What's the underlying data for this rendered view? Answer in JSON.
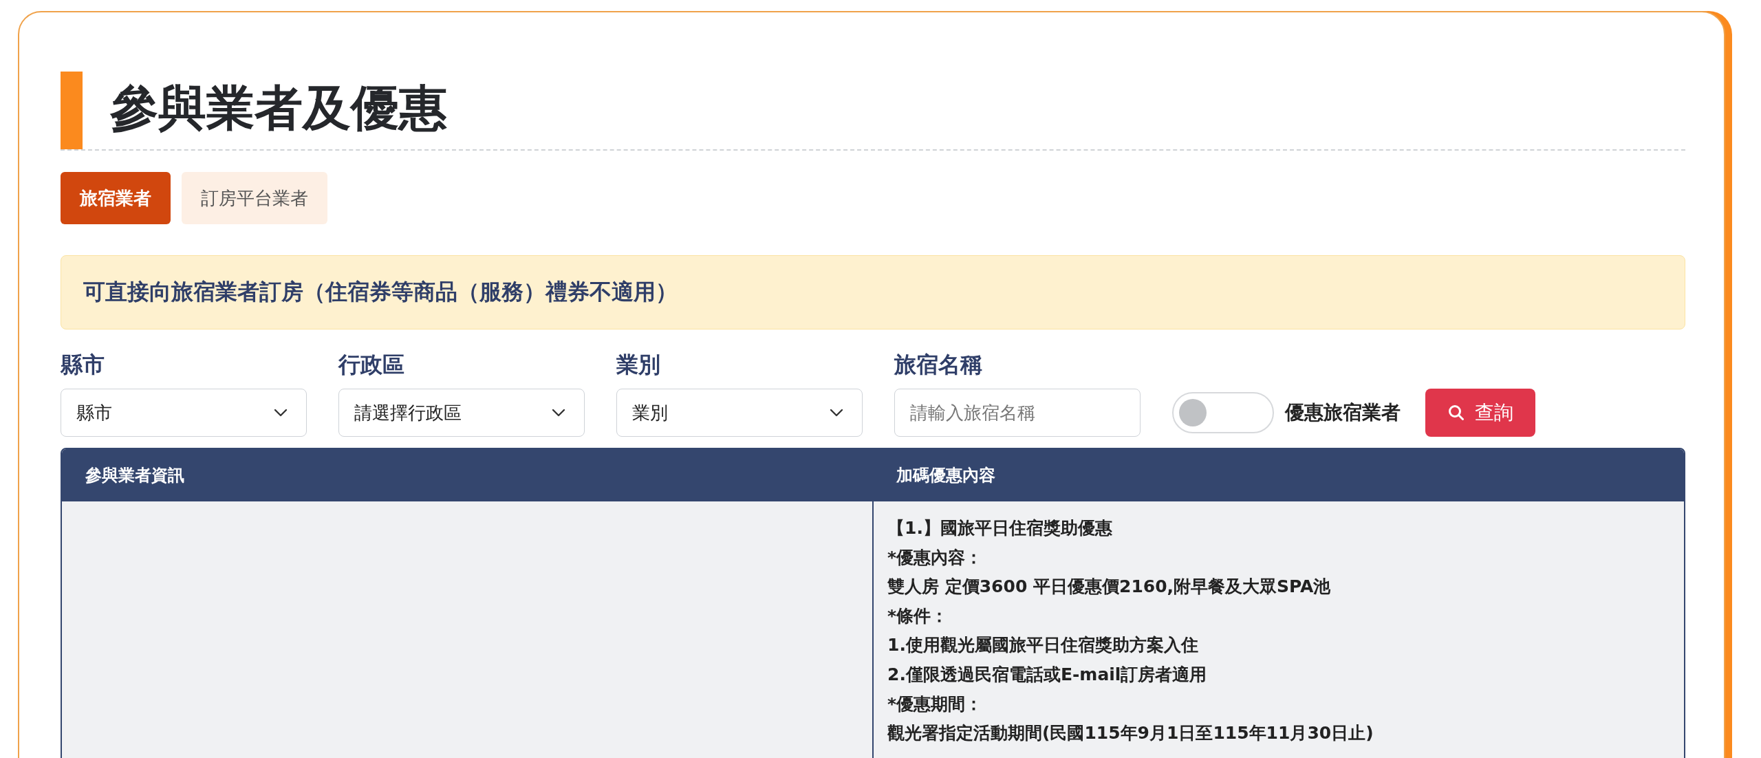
{
  "title": "參與業者及優惠",
  "tabs": [
    {
      "label": "旅宿業者",
      "selected": true
    },
    {
      "label": "訂房平台業者",
      "selected": false
    }
  ],
  "notice": "可直接向旅宿業者訂房（住宿券等商品（服務）禮券不適用）",
  "filters": [
    {
      "kind": "select",
      "label": "縣市",
      "value": "縣市"
    },
    {
      "kind": "select",
      "label": "行政區",
      "value": "請選擇行政區"
    },
    {
      "kind": "select",
      "label": "業別",
      "value": "業別"
    },
    {
      "kind": "input",
      "label": "旅宿名稱",
      "placeholder": "請輸入旅宿名稱"
    }
  ],
  "toggle": {
    "label": "優惠旅宿業者",
    "on": false
  },
  "search_button": "查詢",
  "table": {
    "columns": [
      "參與業者資訊",
      "加碼優惠內容"
    ],
    "rows": [
      {
        "offer_lines": [
          "【1.】國旅平日住宿獎助優惠",
          "*優惠內容：",
          "雙人房 定價3600 平日優惠價2160,附早餐及大眾SPA池",
          "*條件：",
          "1.使用觀光屬國旅平日住宿獎助方案入住",
          "2.僅限透過民宿電話或E-mail訂房者適用",
          "*優惠期間：",
          "觀光署指定活動期間(民國115年9月1日至115年11月30日止)"
        ]
      }
    ]
  }
}
